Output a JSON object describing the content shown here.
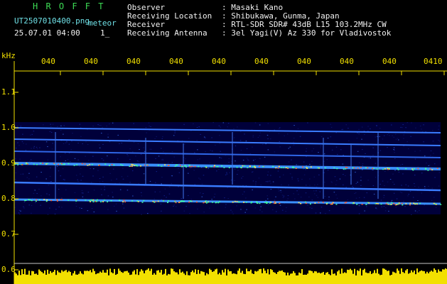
{
  "header": {
    "station": "H R O F F T",
    "filename": "UT2507010400.png",
    "mode": "meteor",
    "datetime": "25.07.01 04:00",
    "counter": "1_",
    "info": [
      {
        "label": "Observer",
        "value": ": Masaki Kano"
      },
      {
        "label": "Receiving Location",
        "value": ": Shibukawa, Gunma, Japan"
      },
      {
        "label": "Receiver",
        "value": ": RTL-SDR SDR# 43dB L15 103.2MHz CW"
      },
      {
        "label": "Receiving Antenna",
        "value": ": 3el Yagi(V) Az 330 for Vladivostok"
      }
    ]
  },
  "chart_data": {
    "type": "heatmap",
    "ylabel": "kHz",
    "y_ticks": [
      "1.1",
      "1.0",
      "0.9",
      "0.8",
      "0.7",
      "0.6"
    ],
    "x_ticks": [
      "040",
      "040",
      "040",
      "040",
      "040",
      "040",
      "040",
      "040",
      "040",
      "0410"
    ],
    "colors": {
      "axis": "#f2e000",
      "background": "#000000",
      "signal": "#2a6cff"
    }
  }
}
